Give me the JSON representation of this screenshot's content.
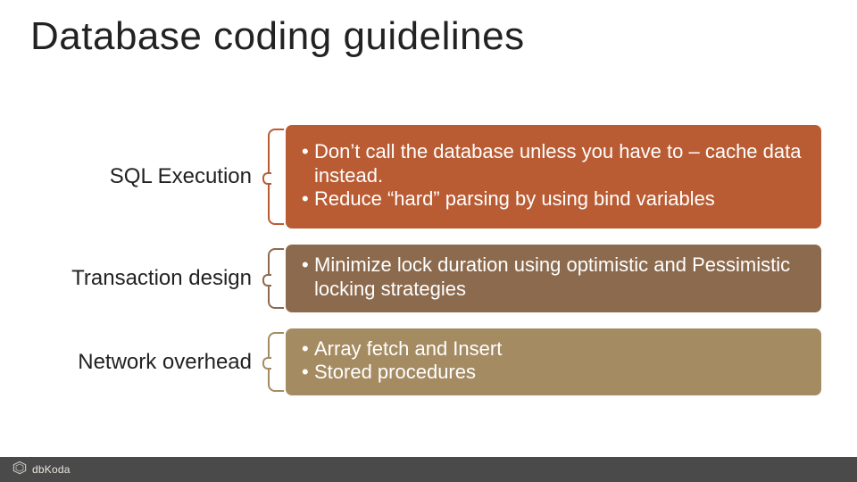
{
  "title": "Database coding guidelines",
  "sections": [
    {
      "label": "SQL Execution",
      "bullets": [
        "Don’t call the database unless you have to – cache data instead.",
        "Reduce “hard” parsing by using bind variables"
      ]
    },
    {
      "label": "Transaction design",
      "bullets": [
        "Minimize lock duration using optimistic and Pessimistic locking strategies"
      ]
    },
    {
      "label": "Network overhead",
      "bullets": [
        "Array fetch and Insert",
        "Stored procedures"
      ]
    }
  ],
  "footer": {
    "brand": "dbKoda"
  },
  "colors": {
    "section1": "#b95c33",
    "section2": "#8c6a4d",
    "section3": "#a58b62",
    "footer_bg": "#4a4a4a"
  }
}
